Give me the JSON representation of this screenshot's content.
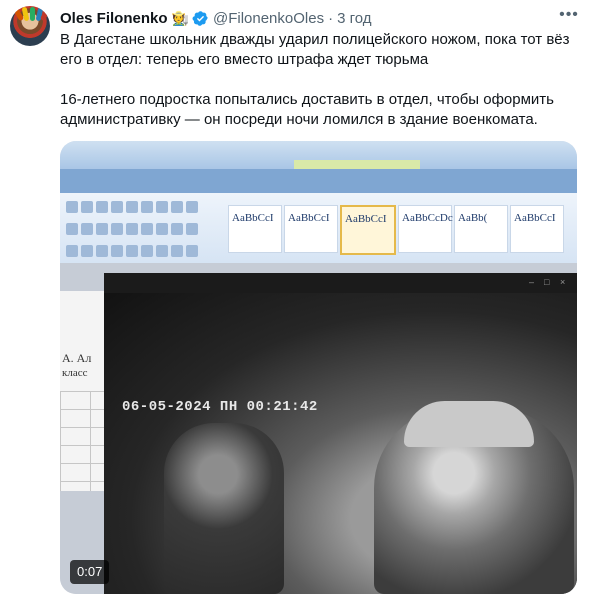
{
  "tweet": {
    "author_name": "Oles Filonenko",
    "author_emoji": "🧑‍🌾",
    "handle": "@FilonenkoOles",
    "separator": "·",
    "time": "3 год",
    "more_icon": "•••",
    "paragraph_1": "В Дагестане школьник дважды ударил полицейского ножом, пока тот вёз его в отдел: теперь его вместо штрафа ждет тюрьма",
    "paragraph_2": "16-летнего подростка попытались доставить в отдел, чтобы оформить административку — он посреди ночи ломился в здание военкомата."
  },
  "media": {
    "duration": "0:07",
    "camera_timestamp": "06-05-2024 ПН 00:21:42",
    "word_style_labels": [
      "AaBbCcI",
      "AaBbCcI",
      "AaBbCcI",
      "AaBbCcDc",
      "AaBb(",
      "AaBbCcI"
    ],
    "word_page_text_1": "А. Ал",
    "word_page_text_2": "класс"
  },
  "colors": {
    "verified_badge": "#1d9bf0",
    "secondary_text": "#536471",
    "primary_text": "#0f1419"
  }
}
